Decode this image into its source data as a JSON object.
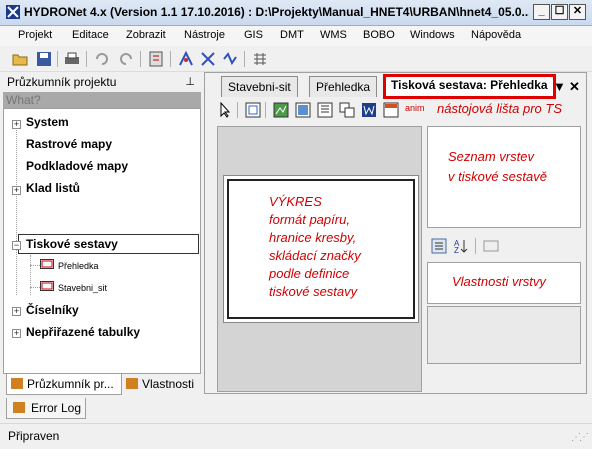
{
  "window": {
    "title": "HYDRONet 4.x (Version 1.1 17.10.2016) : D:\\Projekty\\Manual_HNET4\\URBAN\\hnet4_05.0...",
    "minimize": "_",
    "maximize": "☐",
    "close": "✕"
  },
  "menu": [
    "Projekt",
    "Editace",
    "Zobrazit",
    "Nástroje",
    "GIS",
    "DMT",
    "WMS",
    "BOBO",
    "Windows",
    "Nápověda"
  ],
  "left_panel": {
    "title": "Průzkumník projektu",
    "pin": "⊥",
    "search_placeholder": "What?",
    "tree": [
      "System",
      "Rastrové mapy",
      "Podkladové mapy",
      "Klad listů",
      "Tiskové sestavy",
      "Číselníky",
      "Nepřiřazené tabulky"
    ],
    "children": [
      "Přehledka",
      "Stavebni_sit"
    ],
    "bottom_tabs": [
      "Průzkumník pr...",
      "Vlastnosti"
    ]
  },
  "doc_tabs": [
    "Stavebni-sit",
    "Přehledka",
    "Tisková sestava: Přehledka"
  ],
  "tab_controls": {
    "dropdown": "▼",
    "close": "✕"
  },
  "ts_toolbar": {
    "annotation": "nástojová lišta pro TS",
    "anim_label": "anim"
  },
  "canvas": {
    "text": [
      "VÝKRES",
      "formát papíru,",
      "hranice kresby,",
      "skládací značky",
      "podle definice",
      "tiskové sestavy"
    ]
  },
  "layers": {
    "text": [
      "Seznam vrstev",
      "v tiskové sestavě"
    ]
  },
  "properties": {
    "text": "Vlastnosti vrstvy"
  },
  "error_log": "Error Log",
  "status": {
    "text": "Připraven"
  },
  "colors": {
    "annotation": "#d00000",
    "highlight_border": "#e00000"
  }
}
